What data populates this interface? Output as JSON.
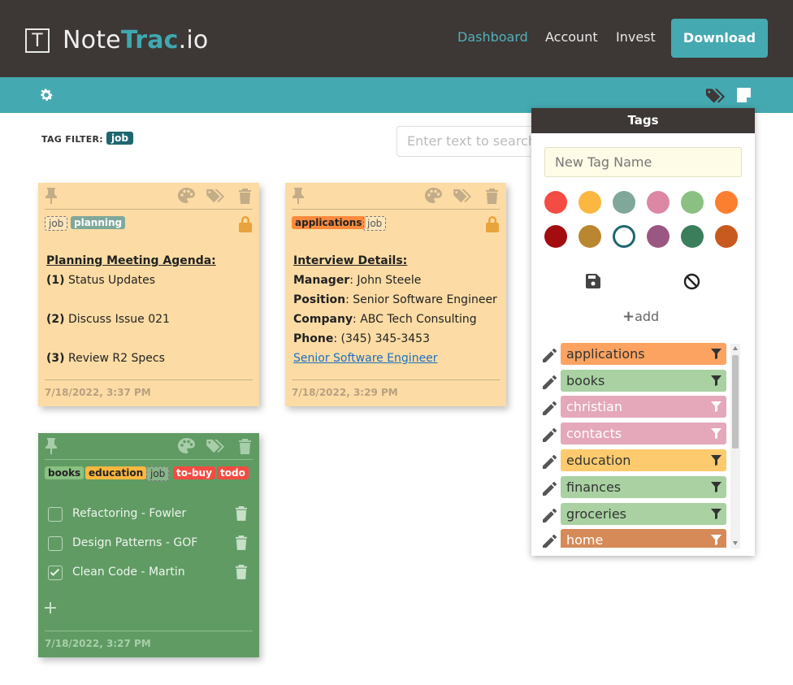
{
  "app": {
    "logo_letter": "T",
    "logo_name_a": "Note",
    "logo_name_b": "Trac",
    "logo_name_c": ".io"
  },
  "nav": {
    "dashboard": "Dashboard",
    "account": "Account",
    "invest": "Invest",
    "download": "Download"
  },
  "filter": {
    "label": "TAG FILTER:",
    "active_tag": "job",
    "search_placeholder": "Enter text to search"
  },
  "notes": [
    {
      "color": "#fcdca4",
      "tags": [
        "job",
        "planning"
      ],
      "title": "Planning Meeting Agenda:",
      "lines": [
        {
          "num": "(1)",
          "text": " Status Updates"
        },
        {
          "num": "(2)",
          "text": " Discuss Issue 021"
        },
        {
          "num": "(3)",
          "text": " Review R2 Specs"
        }
      ],
      "date": "7/18/2022, 3:37 PM"
    },
    {
      "color": "#fcdca4",
      "tags": [
        "applications",
        "job"
      ],
      "title": "Interview Details:",
      "fields": [
        {
          "label": "Manager",
          "value": ": John Steele"
        },
        {
          "label": "Position",
          "value": ": Senior Software Engineer"
        },
        {
          "label": "Company",
          "value": ": ABC Tech Consulting"
        },
        {
          "label": "Phone",
          "value": ": (345) 345-3453"
        }
      ],
      "link": "Senior Software Engineer",
      "date": "7/18/2022, 3:29 PM"
    },
    {
      "color": "#609b63",
      "tags": [
        "books",
        "education",
        "job",
        "to-buy",
        "todo"
      ],
      "todos": [
        {
          "text": "Refactoring - Fowler",
          "done": false
        },
        {
          "text": "Design Patterns - GOF",
          "done": false
        },
        {
          "text": "Clean Code - Martin",
          "done": true
        }
      ],
      "date": "7/18/2022, 3:27 PM"
    }
  ],
  "tags_panel": {
    "title": "Tags",
    "new_tag_placeholder": "New Tag Name",
    "add_label": "add",
    "colors_row1": [
      "#f44b42",
      "#fbb73f",
      "#7fa89b",
      "#dc87a3",
      "#8ac182",
      "#fc7e2f"
    ],
    "colors_row2": [
      "#a30d10",
      "#bb8630",
      "#ffffff",
      "#9a5782",
      "#3b7e5c",
      "#c85a1f"
    ],
    "selected_color_ring": "#1f6670",
    "tags": [
      {
        "name": "applications",
        "color": "#fca361"
      },
      {
        "name": "books",
        "color": "#a9d1a2"
      },
      {
        "name": "christian",
        "color": "#e4a8ba"
      },
      {
        "name": "contacts",
        "color": "#e4a8ba"
      },
      {
        "name": "education",
        "color": "#fdcb6d"
      },
      {
        "name": "finances",
        "color": "#a9d1a2"
      },
      {
        "name": "groceries",
        "color": "#a9d1a2"
      },
      {
        "name": "home",
        "color": "#d58a58"
      }
    ]
  }
}
